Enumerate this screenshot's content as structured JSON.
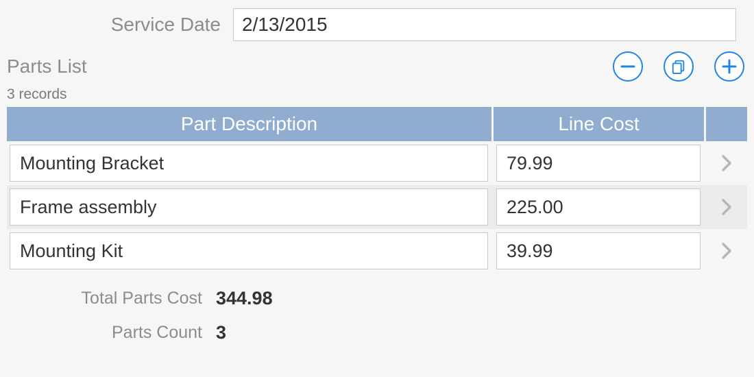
{
  "form": {
    "service_date_label": "Service Date",
    "service_date_value": "2/13/2015"
  },
  "list": {
    "title": "Parts List",
    "records_count_text": "3 records",
    "columns": {
      "description": "Part Description",
      "cost": "Line Cost"
    },
    "rows": [
      {
        "description": "Mounting Bracket",
        "cost": "79.99",
        "selected": false
      },
      {
        "description": "Frame assembly",
        "cost": "225.00",
        "selected": true
      },
      {
        "description": "Mounting Kit",
        "cost": "39.99",
        "selected": false
      }
    ]
  },
  "summary": {
    "total_label": "Total Parts Cost",
    "total_value": "344.98",
    "count_label": "Parts Count",
    "count_value": "3"
  },
  "icons": {
    "remove": "minus-icon",
    "duplicate": "duplicate-icon",
    "add": "plus-icon",
    "chevron": "chevron-right-icon"
  },
  "colors": {
    "accent": "#1f85e5",
    "header_bg": "#90add0",
    "label_gray": "#8c8c8c",
    "chevron_gray": "#b6b6b6"
  }
}
